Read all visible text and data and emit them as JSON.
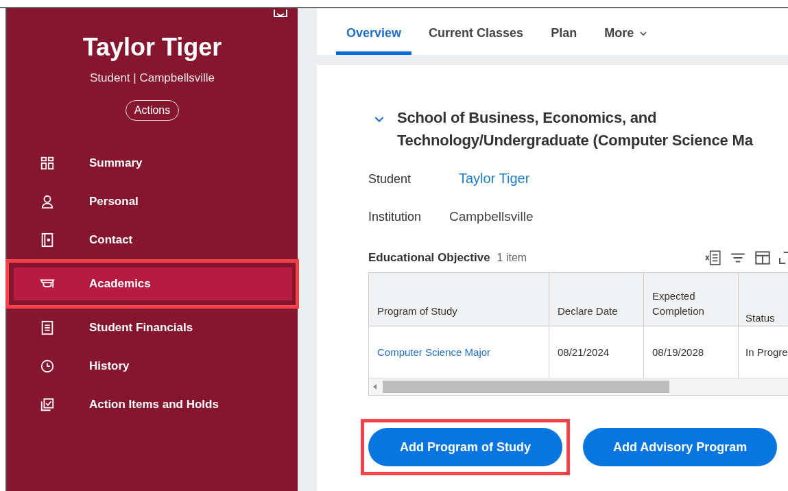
{
  "profile": {
    "name": "Taylor Tiger",
    "subtitle": "Student | Campbellsville",
    "actions_button": "Actions"
  },
  "sidebar": {
    "items": [
      {
        "label": "Summary",
        "selected": false,
        "highlighted": false
      },
      {
        "label": "Personal",
        "selected": false,
        "highlighted": false
      },
      {
        "label": "Contact",
        "selected": false,
        "highlighted": false
      },
      {
        "label": "Academics",
        "selected": true,
        "highlighted": true
      },
      {
        "label": "Student Financials",
        "selected": false,
        "highlighted": false
      },
      {
        "label": "History",
        "selected": false,
        "highlighted": false
      },
      {
        "label": "Action Items and Holds",
        "selected": false,
        "highlighted": false
      }
    ]
  },
  "tabs": [
    {
      "label": "Overview",
      "selected": true,
      "dropdown": false
    },
    {
      "label": "Current Classes",
      "selected": false,
      "dropdown": false
    },
    {
      "label": "Plan",
      "selected": false,
      "dropdown": false
    },
    {
      "label": "More",
      "selected": false,
      "dropdown": true
    }
  ],
  "section": {
    "expanded": true,
    "heading_lines": [
      "School of Business, Economics, and",
      "Technology/Undergraduate (Computer Science Ma"
    ]
  },
  "fields": [
    {
      "label": "Student",
      "value": "Taylor Tiger",
      "kind": "link"
    },
    {
      "label": "Institution",
      "value": "Campbellsville",
      "kind": "text"
    }
  ],
  "table": {
    "title": "Educational Objective",
    "count": "1 item",
    "columns": [
      "Program of Study",
      "Declare Date",
      "Expected Completion",
      "Status"
    ],
    "rows": [
      [
        {
          "text": "Computer Science Major",
          "kind": "link"
        },
        {
          "text": "08/21/2024",
          "kind": "text"
        },
        {
          "text": "08/19/2028",
          "kind": "text"
        },
        {
          "text": "In Progre",
          "kind": "text"
        }
      ]
    ]
  },
  "buttons": [
    {
      "label": "Add Program of Study",
      "highlighted": true
    },
    {
      "label": "Add Advisory Program",
      "highlighted": false
    }
  ]
}
